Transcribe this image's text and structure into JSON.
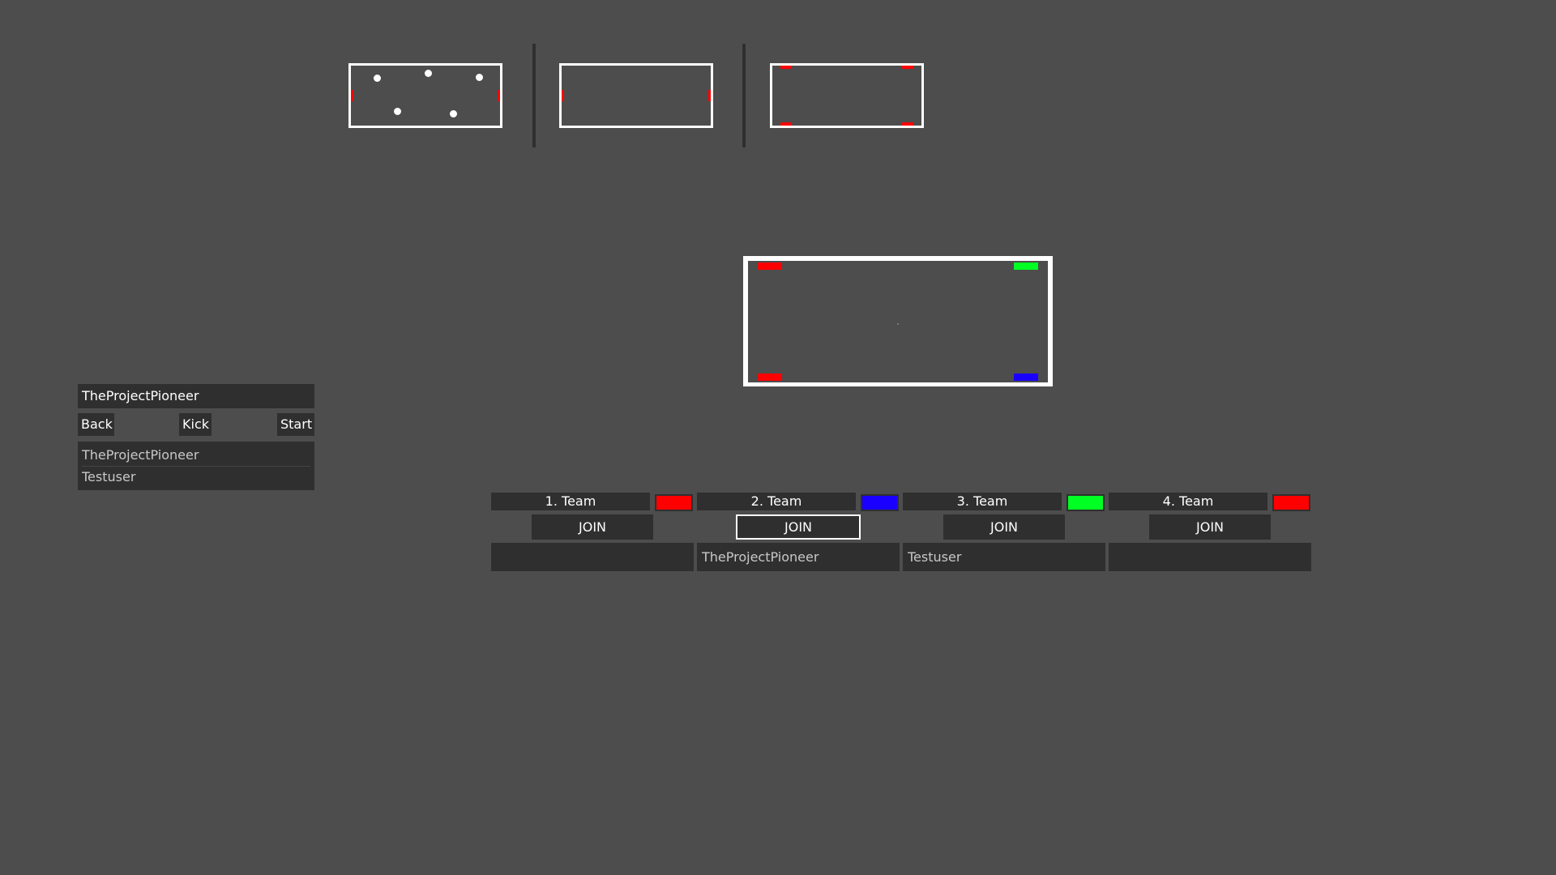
{
  "maps": [
    {
      "name": "map-preview-1",
      "style": "balls"
    },
    {
      "name": "map-preview-2",
      "style": "side-goals"
    },
    {
      "name": "map-preview-3",
      "style": "corner-goals"
    }
  ],
  "colors": {
    "background": "#4d4d4d",
    "panel": "#2f2f2f",
    "red": "#ff0000",
    "blue": "#1a00ff",
    "green": "#00ff22"
  },
  "lobby": {
    "host_name": "TheProjectPioneer",
    "back_label": "Back",
    "kick_label": "Kick",
    "start_label": "Start",
    "players": [
      "TheProjectPioneer",
      "Testuser"
    ]
  },
  "teams": [
    {
      "label": "1. Team",
      "color": "#ff0000",
      "join_label": "JOIN",
      "members": ""
    },
    {
      "label": "2. Team",
      "color": "#1a00ff",
      "join_label": "JOIN",
      "members": "TheProjectPioneer"
    },
    {
      "label": "3. Team",
      "color": "#00ff22",
      "join_label": "JOIN",
      "members": "Testuser"
    },
    {
      "label": "4. Team",
      "color": "#ff0000",
      "join_label": "JOIN",
      "members": ""
    }
  ]
}
